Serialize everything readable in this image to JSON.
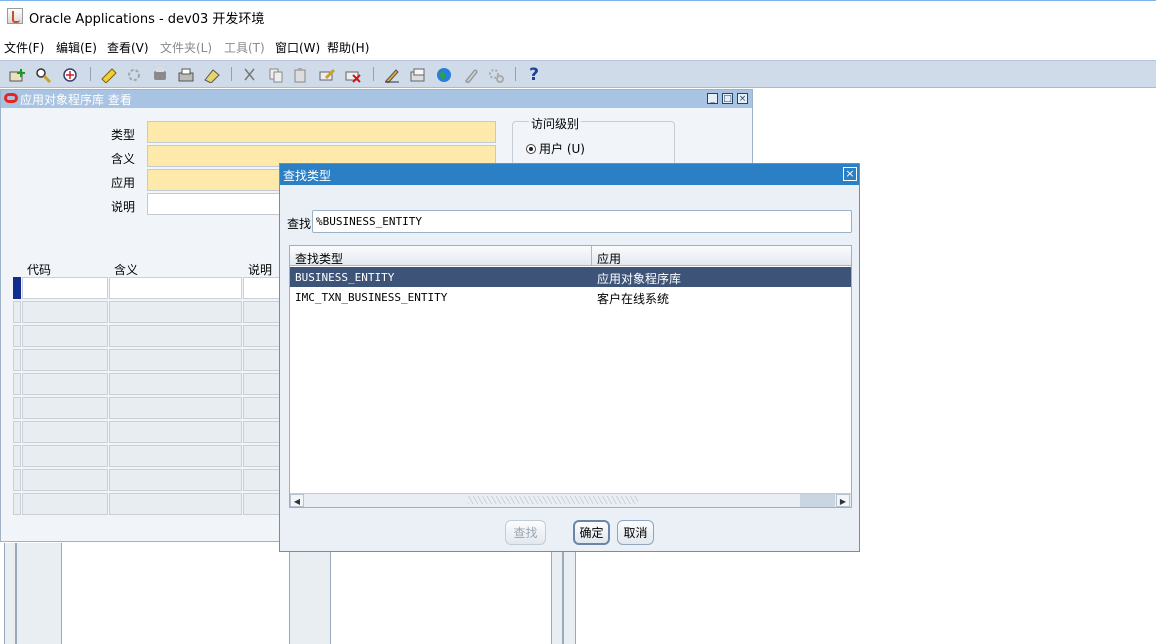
{
  "window": {
    "title": "Oracle Applications - dev03 开发环境"
  },
  "menu": [
    {
      "label": "文件(F)",
      "enabled": true
    },
    {
      "label": "编辑(E)",
      "enabled": true
    },
    {
      "label": "查看(V)",
      "enabled": true
    },
    {
      "label": "文件夹(L)",
      "enabled": false
    },
    {
      "label": "工具(T)",
      "enabled": false
    },
    {
      "label": "窗口(W)",
      "enabled": true
    },
    {
      "label": "帮助(H)",
      "enabled": true
    }
  ],
  "toolbar_icons": [
    "new-record-icon",
    "find-icon",
    "navigator-icon",
    "save-icon",
    "next-step-icon",
    "print-icon",
    "close-form-icon",
    "cut-icon",
    "copy-icon",
    "paste-icon",
    "clear-record-icon",
    "delete-record-icon",
    "edit-field-icon",
    "zoom-icon",
    "translations-icon",
    "attachments-icon",
    "folder-tools-icon",
    "help-icon"
  ],
  "form": {
    "title": "应用对象程序库 查看",
    "labels": {
      "type": "类型",
      "meaning": "含义",
      "application": "应用",
      "description": "说明"
    },
    "access_level": {
      "legend": "访问级别",
      "user_option": "用户 (U)"
    },
    "grid_headers": {
      "code": "代码",
      "meaning": "含义",
      "description": "说明"
    }
  },
  "dialog": {
    "title": "查找类型",
    "find_label": "查找",
    "find_value": "%BUSINESS_ENTITY",
    "columns": {
      "type": "查找类型",
      "application": "应用"
    },
    "rows": [
      {
        "type": "BUSINESS_ENTITY",
        "application": "应用对象程序库",
        "selected": true
      },
      {
        "type": "IMC_TXN_BUSINESS_ENTITY",
        "application": "客户在线系统",
        "selected": false
      }
    ],
    "buttons": {
      "find": "查找",
      "ok": "确定",
      "cancel": "取消"
    }
  },
  "colors": {
    "field_required": "#fde9a9",
    "dialog_title": "#2b7fc5",
    "selected_row": "#3d5478",
    "toolbar": "#cfdbe8"
  }
}
